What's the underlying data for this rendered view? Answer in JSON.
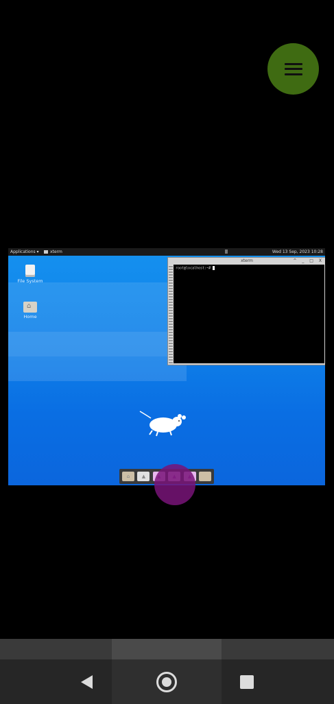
{
  "desktop": {
    "topbar": {
      "applications_label": "Applications ▾",
      "active_task": "xterm",
      "clock": "Wed 13 Sep, 2023 10:28"
    },
    "icons": [
      {
        "label": "File System",
        "icon": "drive-icon"
      },
      {
        "label": "Home",
        "icon": "home-folder-icon"
      }
    ],
    "terminal": {
      "title": "xterm",
      "controls": "^ _ □ X",
      "prompt": "root@localhost:~# "
    },
    "dock": [
      "home-folder-icon",
      "terminal-icon",
      "app-icon",
      "app-icon",
      "app-icon",
      "folder-icon"
    ]
  },
  "colors": {
    "fab": "#3f6b12",
    "desktop_blue": "#0e7ee8",
    "touch_indicator": "#781478"
  }
}
